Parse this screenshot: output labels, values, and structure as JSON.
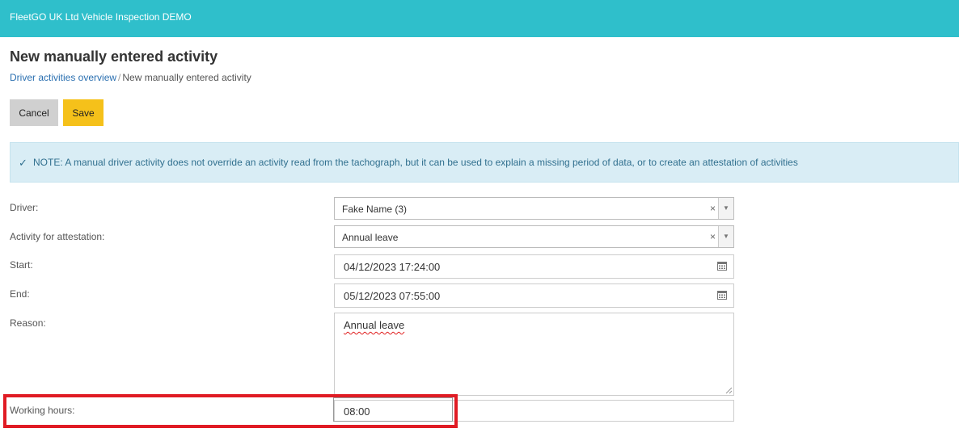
{
  "header": {
    "app_title": "FleetGO UK Ltd Vehicle Inspection DEMO"
  },
  "page": {
    "title": "New manually entered activity"
  },
  "breadcrumb": {
    "link": "Driver activities overview",
    "separator": "/",
    "current": "New manually entered activity"
  },
  "toolbar": {
    "cancel_label": "Cancel",
    "save_label": "Save"
  },
  "note": {
    "text": "NOTE: A manual driver activity does not override an activity read from the tachograph, but it can be used to explain a missing period of data, or to create an attestation of activities"
  },
  "form": {
    "driver": {
      "label": "Driver:",
      "value": "Fake Name (3)"
    },
    "activity": {
      "label": "Activity for attestation:",
      "value": "Annual leave"
    },
    "start": {
      "label": "Start:",
      "value": "04/12/2023 17:24:00"
    },
    "end": {
      "label": "End:",
      "value": "05/12/2023 07:55:00"
    },
    "reason": {
      "label": "Reason:",
      "value": "Annual leave"
    },
    "working_hours": {
      "label": "Working hours:",
      "value": "08:00"
    }
  },
  "colors": {
    "header": "#2fbfcb",
    "save": "#f5c11a",
    "highlight": "#e01b24",
    "note_bg": "#d9edf5"
  }
}
